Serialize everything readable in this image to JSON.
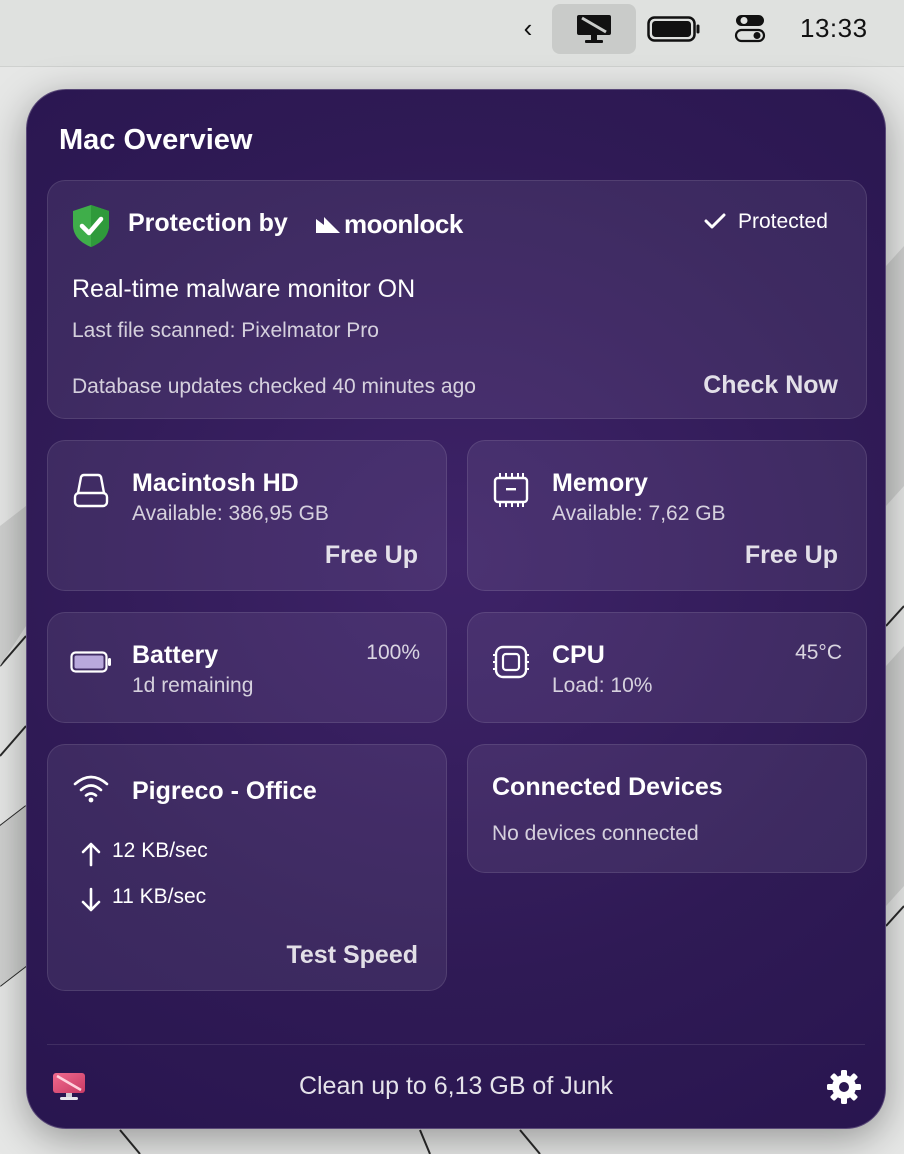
{
  "menubar": {
    "chevron": "‹",
    "clock": "13:33",
    "icons": [
      "chevron-left-icon",
      "cleanmymac-menu-icon",
      "battery-icon",
      "control-center-icon"
    ]
  },
  "panel": {
    "title": "Mac Overview",
    "protection": {
      "title": "Protection by",
      "brand": "moonlock",
      "status": "Protected",
      "headline": "Real-time malware monitor ON",
      "last_scanned": "Last file scanned: Pixelmator Pro",
      "database": "Database updates checked 40 minutes ago",
      "action": "Check Now"
    },
    "disk": {
      "title": "Macintosh HD",
      "subtitle": "Available: 386,95 GB",
      "action": "Free Up"
    },
    "memory": {
      "title": "Memory",
      "subtitle": "Available: 7,62 GB",
      "action": "Free Up"
    },
    "battery": {
      "title": "Battery",
      "subtitle": "1d remaining",
      "level": "100%",
      "level_fraction": 1.0
    },
    "cpu": {
      "title": "CPU",
      "subtitle": "Load: 10%",
      "temp": "45°C"
    },
    "network": {
      "title": "Pigreco - Office",
      "upload": "12 KB/sec",
      "download": "11 KB/sec",
      "action": "Test Speed"
    },
    "devices": {
      "title": "Connected Devices",
      "subtitle": "No devices connected"
    },
    "footer": {
      "text": "Clean up to 6,13 GB of Junk"
    }
  },
  "colors": {
    "panel_bg": "#2f1a55",
    "shield_green": "#3fae4a",
    "accent_pink": "#e8557d"
  }
}
